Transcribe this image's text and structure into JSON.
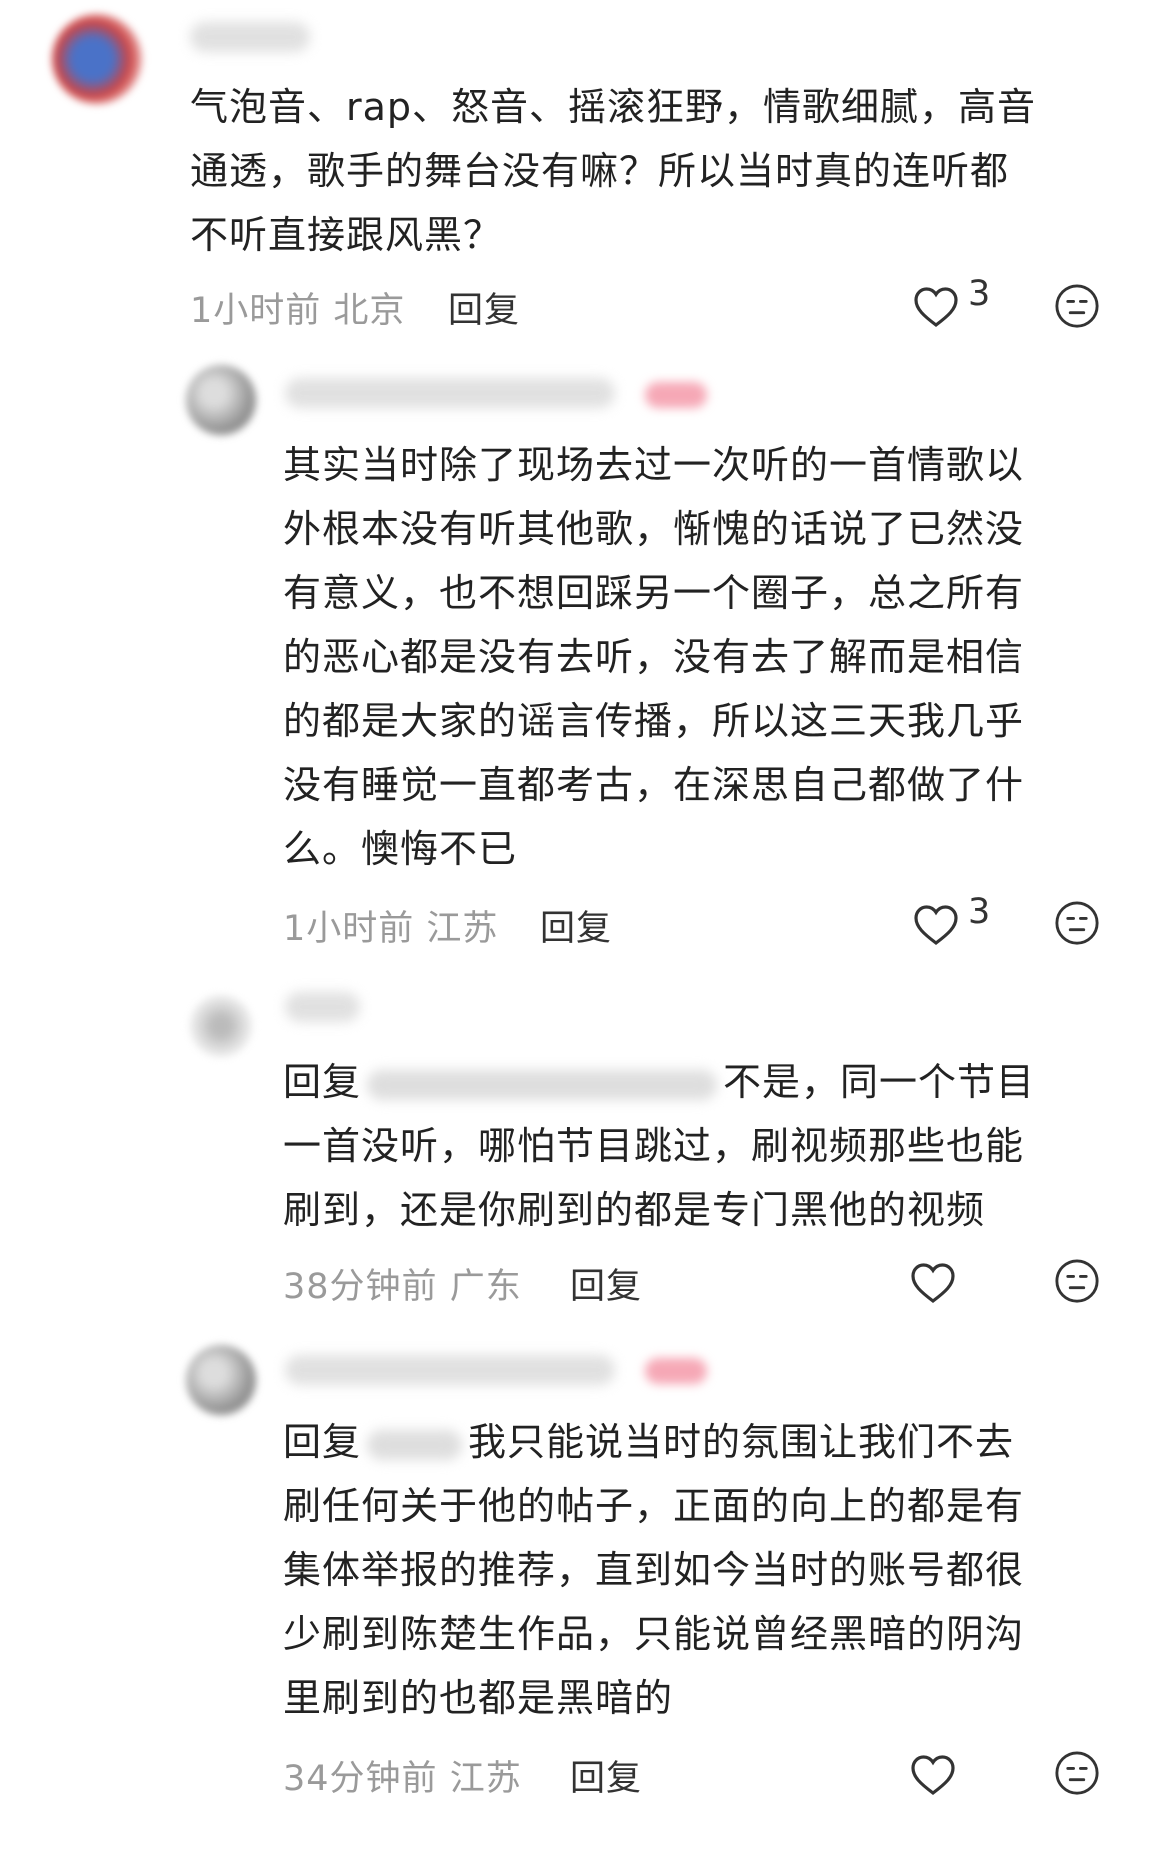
{
  "comments": [
    {
      "text": "气泡音、rap、怒音、摇滚狂野，情歌细腻，高音通透，歌手的舞台没有嘛？所以当时真的连听都不听直接跟风黑？",
      "lines": [
        "气泡音、rap、怒音、摇滚狂野，情歌细腻，高音",
        "通透，歌手的舞台没有嘛？所以当时真的连听都",
        "不听直接跟风黑？"
      ],
      "time": "1小时前",
      "location": "北京",
      "reply_label": "回复",
      "likes": "3"
    },
    {
      "lines": [
        "其实当时除了现场去过一次听的一首情歌以",
        "外根本没有听其他歌，惭愧的话说了已然没",
        "有意义，也不想回踩另一个圈子，总之所有",
        "的恶心都是没有去听，没有去了解而是相信",
        "的都是大家的谣言传播，所以这三天我几乎",
        "没有睡觉一直都考古，在深思自己都做了什",
        "么。懊悔不已"
      ],
      "time": "1小时前",
      "location": "江苏",
      "reply_label": "回复",
      "likes": "3"
    },
    {
      "reply_prefix": "回复",
      "first_line_rest": "不是，同一个节目",
      "lines": [
        "一首没听，哪怕节目跳过，刷视频那些也能",
        "刷到，还是你刷到的都是专门黑他的视频"
      ],
      "time": "38分钟前",
      "location": "广东",
      "reply_label": "回复"
    },
    {
      "reply_prefix": "回复",
      "first_line_rest": "我只能说当时的氛围让我们不去",
      "lines": [
        "刷任何关于他的帖子，正面的向上的都是有",
        "集体举报的推荐，直到如今当时的账号都很",
        "少刷到陈楚生作品，只能说曾经黑暗的阴沟",
        "里刷到的也都是黑暗的"
      ],
      "time": "34分钟前",
      "location": "江苏",
      "reply_label": "回复"
    }
  ],
  "colors": {
    "meta": "#9a9a9a",
    "text": "#222222",
    "tag": "#f6a8b6"
  },
  "icons": {
    "like": "heart-outline-icon",
    "dislike": "neutral-face-icon"
  }
}
